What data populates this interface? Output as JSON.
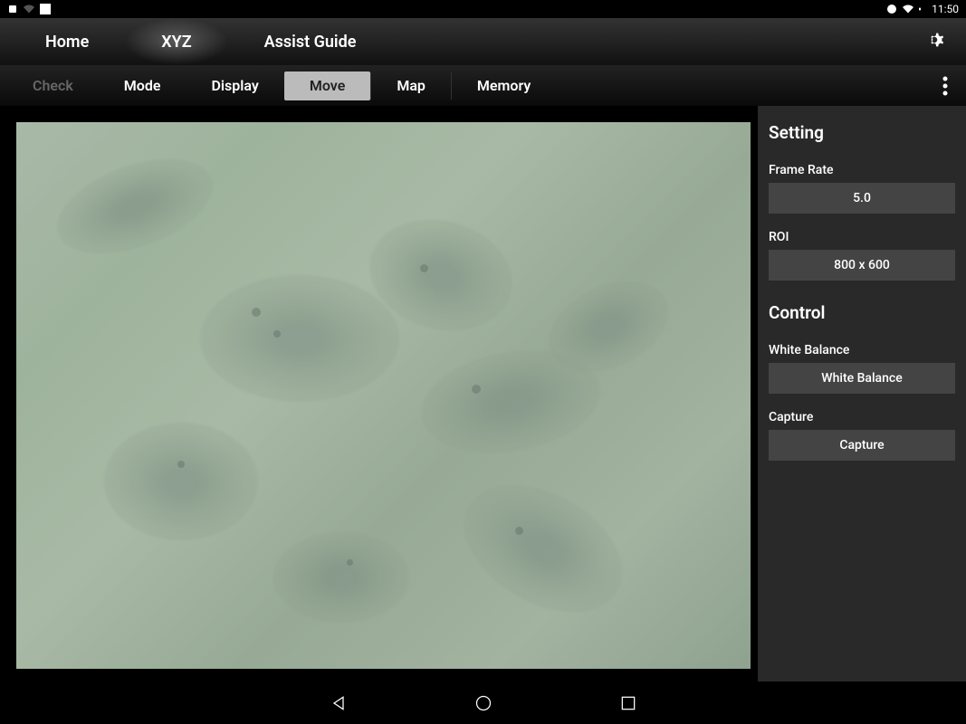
{
  "status_bar": {
    "time": "11:50"
  },
  "top_nav": {
    "items": [
      {
        "label": "Home",
        "active": false
      },
      {
        "label": "XYZ",
        "active": true
      },
      {
        "label": "Assist Guide",
        "active": false
      }
    ]
  },
  "sub_nav": {
    "items": [
      {
        "label": "Check",
        "state": "disabled"
      },
      {
        "label": "Mode",
        "state": "normal"
      },
      {
        "label": "Display",
        "state": "normal"
      },
      {
        "label": "Move",
        "state": "active"
      },
      {
        "label": "Map",
        "state": "normal"
      },
      {
        "label": "Memory",
        "state": "normal"
      }
    ]
  },
  "side_panel": {
    "setting_header": "Setting",
    "frame_rate_label": "Frame Rate",
    "frame_rate_value": "5.0",
    "roi_label": "ROI",
    "roi_value": "800 x 600",
    "control_header": "Control",
    "white_balance_label": "White Balance",
    "white_balance_button": "White Balance",
    "capture_label": "Capture",
    "capture_button": "Capture"
  }
}
